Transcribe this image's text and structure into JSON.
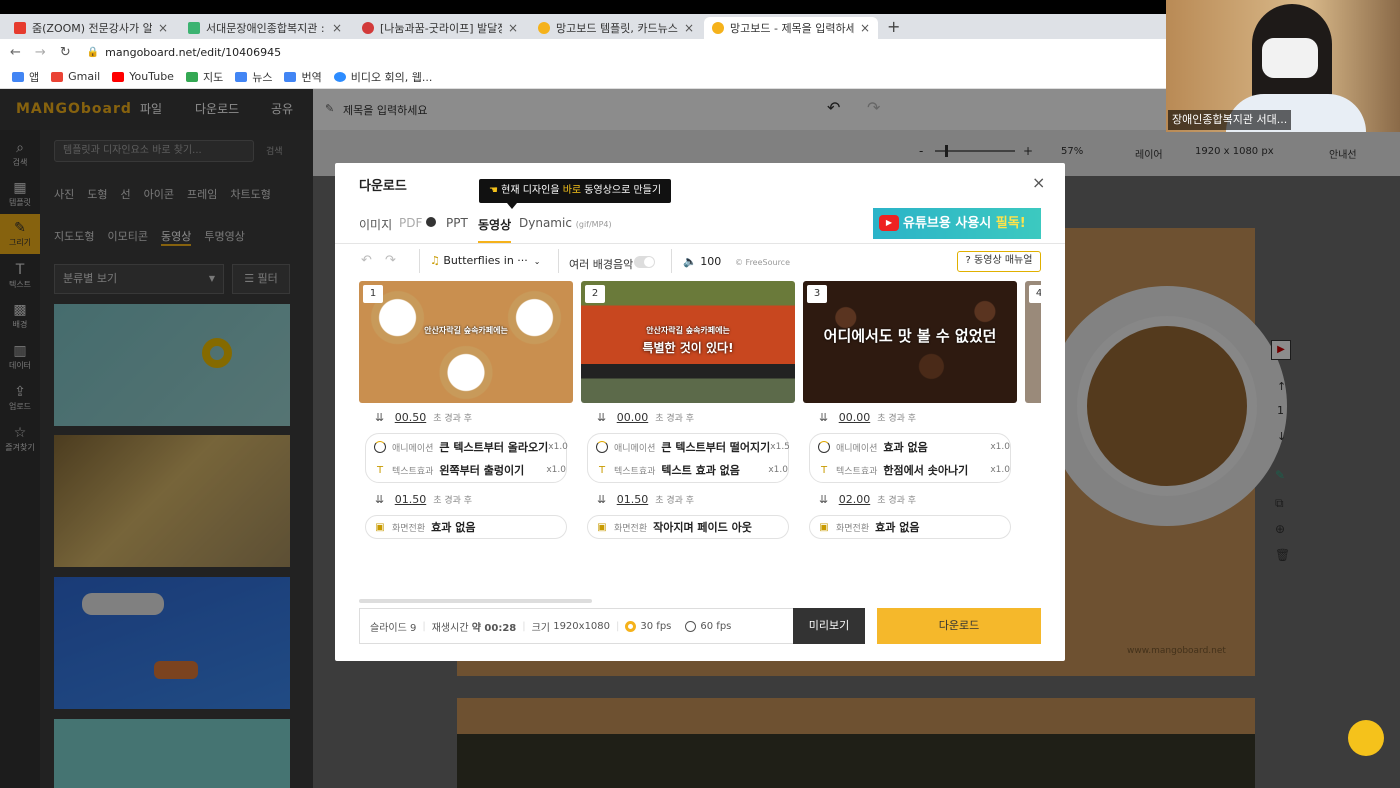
{
  "browser": {
    "tabs": [
      {
        "title": "줌(ZOOM) 전문강사가 알려",
        "color": "#e63b2e"
      },
      {
        "title": "서대문장애인종합복지관 :",
        "color": "#3cb371"
      },
      {
        "title": "[나눔과꿈-굿라이프] 발달장",
        "color": "#d23a3a"
      },
      {
        "title": "망고보드 템플릿, 카드뉴스",
        "color": "#f5b21b"
      },
      {
        "title": "망고보드 - 제목을 입력하세",
        "color": "#f5b21b"
      }
    ],
    "new_tab": "+",
    "close": "×",
    "url": "mangoboard.net/edit/10406945",
    "bookmarks": [
      {
        "label": "앱",
        "color": "#4285f4"
      },
      {
        "label": "Gmail",
        "color": "#ea4335"
      },
      {
        "label": "YouTube",
        "color": "#ff0000"
      },
      {
        "label": "지도",
        "color": "#34a853"
      },
      {
        "label": "뉴스",
        "color": "#4285f4"
      },
      {
        "label": "번역",
        "color": "#4285f4"
      },
      {
        "label": "비디오 회의, 웹...",
        "color": "#2d8cff"
      }
    ]
  },
  "zoom": {
    "participant": "장애인종합복지관 서대..."
  },
  "app": {
    "logo": "MANGOboard",
    "menu": [
      "파일",
      "다운로드",
      "공유"
    ],
    "doc_title": "제목을 입력하세요",
    "search_placeholder": "템플릿과 디자인요소 바로 찾기...",
    "search_btn": "검색",
    "side": [
      {
        "icon": "⌕",
        "label": "검색"
      },
      {
        "icon": "▦",
        "label": "템플릿"
      },
      {
        "icon": "✎",
        "label": "그리기"
      },
      {
        "icon": "T",
        "label": "텍스트"
      },
      {
        "icon": "▩",
        "label": "배경"
      },
      {
        "icon": "▥",
        "label": "데이터"
      },
      {
        "icon": "⇪",
        "label": "업로드"
      },
      {
        "icon": "☆",
        "label": "즐겨찾기"
      }
    ],
    "cats1": [
      "사진",
      "도형",
      "선",
      "아이콘",
      "프레임",
      "차트도형"
    ],
    "cats2": [
      "지도도형",
      "이모티콘",
      "동영상",
      "투명영상"
    ],
    "sort": "분류별 보기",
    "filter": "필터",
    "toolbar": {
      "zoom": "57%",
      "layer": "레이어",
      "size": "1920 x 1080 px",
      "guide": "안내선",
      "minus": "-",
      "plus": "+"
    },
    "page_no": "1",
    "watermark": "www.mangoboard.net"
  },
  "modal": {
    "title": "다운로드",
    "tooltip_pre": "현재 디자인을 ",
    "tooltip_hl": "바로",
    "tooltip_post": " 동영상으로 만들기",
    "tabs": [
      "이미지",
      "PDF",
      "PPT",
      "동영상"
    ],
    "tab_dynamic": "Dynamic",
    "tab_dynamic_sub": "(gif/MP4)",
    "yt_banner_a": "유튜브용 사용시 ",
    "yt_banner_b": "필독!",
    "music": "Butterflies in ···",
    "multi_bg": "여러 배경음악",
    "volume": "100",
    "freesource": "FreeSource",
    "manual": "동영상 매뉴얼",
    "slides": [
      {
        "num": "1",
        "time": "00.50",
        "after": "초 경과 후",
        "anim_k": "애니메이션",
        "anim": "큰 텍스트부터 올라오기",
        "anim_m": "x1.0",
        "txt_k": "텍스트효과",
        "txt": "왼쪽부터 출렁이기",
        "txt_m": "x1.0",
        "time2": "01.50",
        "trans_k": "화면전환",
        "trans": "효과 없음",
        "caption": "안산자락길 숲속카페에는",
        "caption2": ""
      },
      {
        "num": "2",
        "time": "00.00",
        "after": "초 경과 후",
        "anim_k": "애니메이션",
        "anim": "큰 텍스트부터 떨어지기",
        "anim_m": "x1.5",
        "txt_k": "텍스트효과",
        "txt": "텍스트 효과 없음",
        "txt_m": "x1.0",
        "time2": "01.50",
        "trans_k": "화면전환",
        "trans": "작아지며 페이드 아웃",
        "caption": "안산자락길 숲속카페에는",
        "caption2": "특별한 것이 있다!"
      },
      {
        "num": "3",
        "time": "00.00",
        "after": "초 경과 후",
        "anim_k": "애니메이션",
        "anim": "효과 없음",
        "anim_m": "x1.0",
        "txt_k": "텍스트효과",
        "txt": "한점에서 솟아나기",
        "txt_m": "x1.0",
        "time2": "02.00",
        "trans_k": "화면전환",
        "trans": "효과 없음",
        "caption": "어디에서도 맛 볼 수 없었던",
        "caption2": ""
      }
    ],
    "slide4_num": "4",
    "footer": {
      "slide": "슬라이드 9",
      "dur_k": "재생시간",
      "dur": "약 00:28",
      "size_k": "크기",
      "size": "1920x1080",
      "fps30": "30 fps",
      "fps60": "60 fps",
      "preview": "미리보기",
      "download": "다운로드"
    }
  }
}
